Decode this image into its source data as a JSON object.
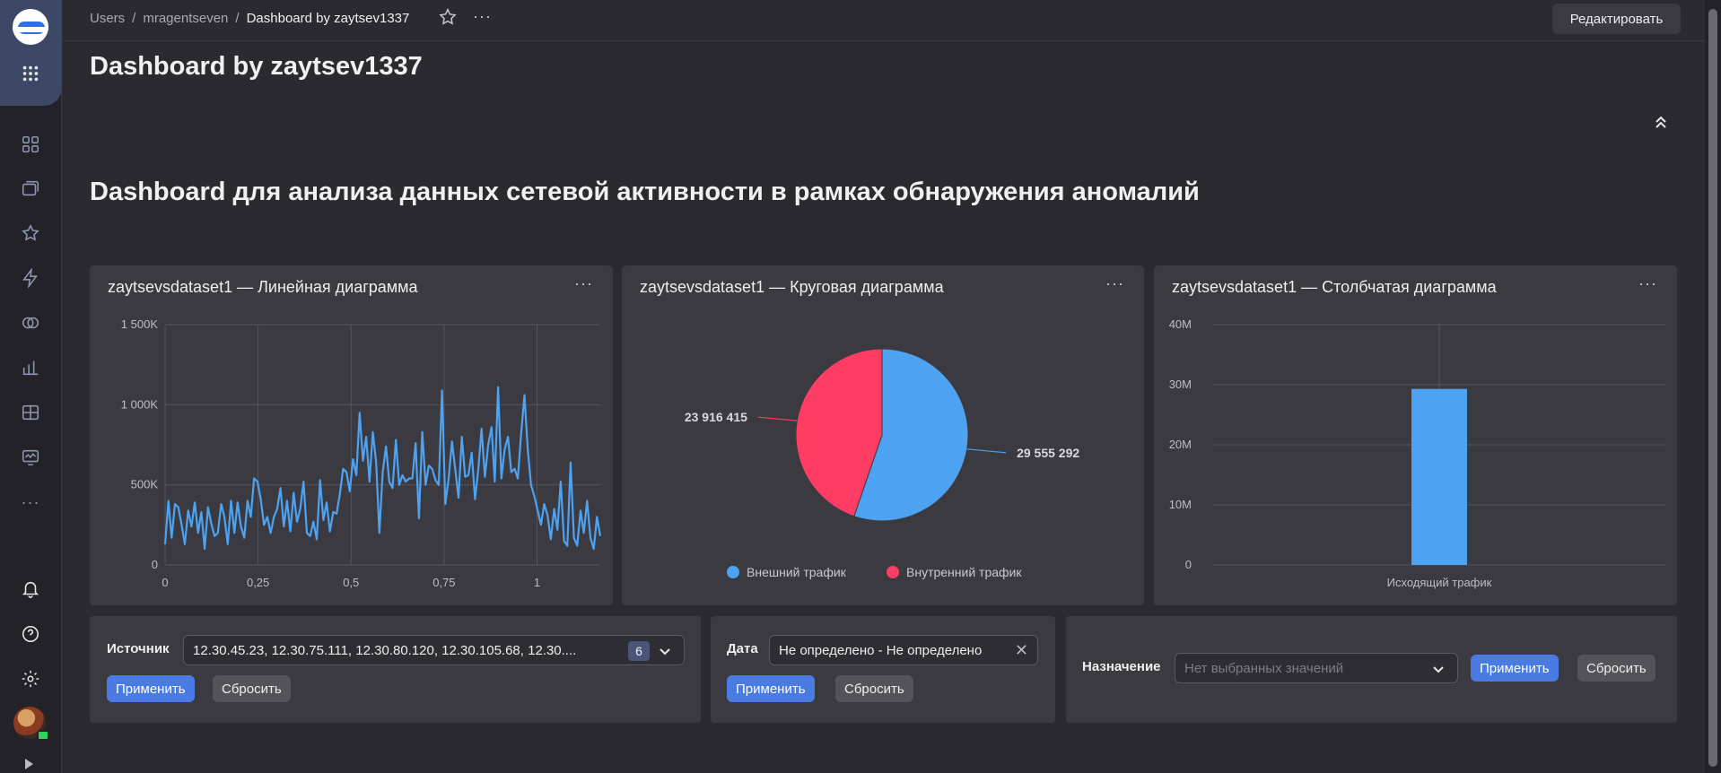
{
  "breadcrumbs": [
    "Users",
    "mragentseven",
    "Dashboard by zaytsev1337"
  ],
  "header": {
    "edit_label": "Редактировать",
    "more_label": "···"
  },
  "page_title": "Dashboard by zaytsev1337",
  "section_title": "Dashboard для анализа данных сетевой активности в рамках обнаружения аномалий",
  "sidebar": {
    "items": [
      "apps-icon",
      "dashboards-icon",
      "collections-icon",
      "favorites-icon",
      "lightning-icon",
      "connections-icon",
      "charts-icon",
      "datasets-icon",
      "monitor-icon",
      "more-icon",
      "notifications-icon",
      "help-icon",
      "settings-icon"
    ],
    "more_label": "···"
  },
  "widgets": {
    "line": {
      "title": "zaytsevsdataset1 — Линейная диаграмма",
      "more_label": "···"
    },
    "pie": {
      "title": "zaytsevsdataset1 — Круговая диаграмма",
      "more_label": "···"
    },
    "bar": {
      "title": "zaytsevsdataset1 — Столбчатая диаграмма",
      "more_label": "···"
    }
  },
  "chart_data": [
    {
      "type": "line",
      "title": "zaytsevsdataset1 — Линейная диаграмма",
      "x_ticks": [
        "0",
        "0,25",
        "0,5",
        "0,75",
        "1"
      ],
      "y_ticks": [
        "0",
        "500K",
        "1 000K",
        "1 500K"
      ],
      "xlim": [
        0,
        1.17
      ],
      "ylim": [
        0,
        1500000
      ],
      "grid": true,
      "color": "#4da2f1",
      "series": [
        {
          "values": [
            130000,
            400000,
            170000,
            380000,
            360000,
            250000,
            130000,
            340000,
            240000,
            390000,
            200000,
            330000,
            100000,
            360000,
            260000,
            180000,
            200000,
            380000,
            300000,
            130000,
            400000,
            200000,
            390000,
            240000,
            170000,
            400000,
            300000,
            540000,
            520000,
            410000,
            250000,
            300000,
            200000,
            300000,
            350000,
            480000,
            240000,
            400000,
            210000,
            450000,
            270000,
            350000,
            520000,
            200000,
            180000,
            270000,
            160000,
            530000,
            280000,
            390000,
            210000,
            330000,
            320000,
            440000,
            600000,
            580000,
            460000,
            660000,
            560000,
            950000,
            650000,
            800000,
            520000,
            830000,
            640000,
            200000,
            580000,
            740000,
            520000,
            480000,
            780000,
            500000,
            560000,
            520000,
            540000,
            540000,
            760000,
            290000,
            830000,
            500000,
            620000,
            600000,
            530000,
            500000,
            1090000,
            380000,
            540000,
            770000,
            600000,
            420000,
            800000,
            550000,
            560000,
            700000,
            410000,
            600000,
            850000,
            550000,
            750000,
            860000,
            520000,
            1110000,
            540000,
            720000,
            800000,
            580000,
            600000,
            540000,
            820000,
            1060000,
            720000,
            500000,
            430000,
            340000,
            250000,
            380000,
            310000,
            160000,
            350000,
            220000,
            520000,
            150000,
            120000,
            640000,
            170000,
            120000,
            340000,
            200000,
            400000,
            170000,
            100000,
            300000,
            180000
          ],
          "x_start": 0,
          "x_end": 1.17
        }
      ]
    },
    {
      "type": "pie",
      "title": "zaytsevsdataset1 — Круговая диаграмма",
      "series": [
        {
          "name": "Внешний трафик",
          "value": 29555292,
          "label": "29 555 292",
          "color": "#4da2f1"
        },
        {
          "name": "Внутренний трафик",
          "value": 23916415,
          "label": "23 916 415",
          "color": "#ff3d64"
        }
      ],
      "legend": "bottom"
    },
    {
      "type": "bar",
      "title": "zaytsevsdataset1 — Столбчатая диаграмма",
      "categories": [
        "Исходящий трафик"
      ],
      "values": [
        29300000
      ],
      "y_ticks": [
        "0",
        "10M",
        "20M",
        "30M",
        "40M"
      ],
      "ylim": [
        0,
        40000000
      ],
      "grid": true,
      "color": "#4da2f1"
    }
  ],
  "selectors": {
    "source": {
      "label": "Источник",
      "value": "12.30.45.23, 12.30.75.111, 12.30.80.120, 12.30.105.68, 12.30....",
      "count": "6"
    },
    "date": {
      "label": "Дата",
      "value": "Не определено - Не определено"
    },
    "purpose": {
      "label": "Назначение",
      "placeholder": "Нет выбранных значений"
    },
    "apply_label": "Применить",
    "reset_label": "Сбросить"
  },
  "colors": {
    "accent": "#4a7be3",
    "series_blue": "#4da2f1",
    "series_red": "#ff3d64",
    "background": "#2b2a30",
    "card": "#3b3a40"
  }
}
